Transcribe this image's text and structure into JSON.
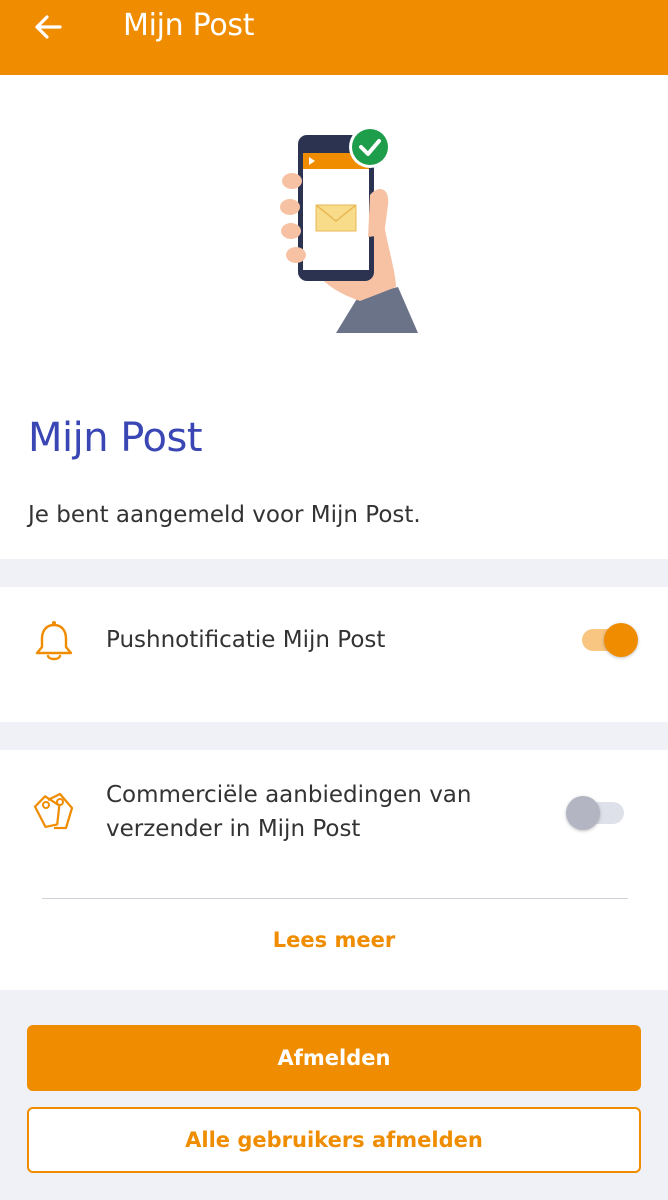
{
  "header": {
    "title": "Mijn Post",
    "back_icon": "arrow-left-icon"
  },
  "intro": {
    "illustration": "phone-in-hand-with-envelope-and-checkmark",
    "title": "Mijn Post",
    "text": "Je bent aangemeld voor Mijn Post."
  },
  "settings": [
    {
      "icon": "bell-icon",
      "label": "Pushnotificatie Mijn Post",
      "enabled": true
    },
    {
      "icon": "price-tags-icon",
      "label_line1": "Commerciële aanbiedingen van",
      "label_line2": "verzender in Mijn Post",
      "enabled": false,
      "read_more": "Lees meer"
    }
  ],
  "actions": {
    "unsubscribe": "Afmelden",
    "unsubscribe_all": "Alle gebruikers afmelden"
  },
  "colors": {
    "brand_orange": "#ef8c00",
    "title_blue": "#3a46b4",
    "background": "#eff1f6"
  }
}
